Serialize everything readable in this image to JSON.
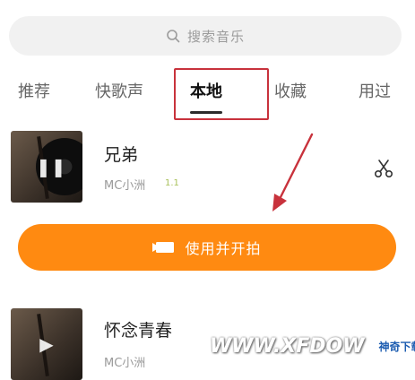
{
  "search": {
    "icon": "search-icon",
    "placeholder": "搜索音乐"
  },
  "tabs": [
    {
      "label": "推荐",
      "active": false
    },
    {
      "label": "快歌声",
      "active": false
    },
    {
      "label": "本地",
      "active": true
    },
    {
      "label": "收藏",
      "active": false
    },
    {
      "label": "用过",
      "active": false
    }
  ],
  "songs": [
    {
      "title": "兄弟",
      "artist": "MC小洲",
      "badge": "1.1",
      "state_icon": "pause-icon",
      "state_glyph": "❚❚"
    },
    {
      "title": "怀念青春",
      "artist": "MC小洲",
      "state_icon": "play-icon",
      "state_glyph": "▶"
    }
  ],
  "action": {
    "icon": "video-camera-icon",
    "label": "使用并开拍"
  },
  "colors": {
    "accent": "#ff8a11",
    "highlight": "#c8323c"
  },
  "watermark": {
    "text": "WWW.XFDOW",
    "site": "神奇下载站"
  }
}
